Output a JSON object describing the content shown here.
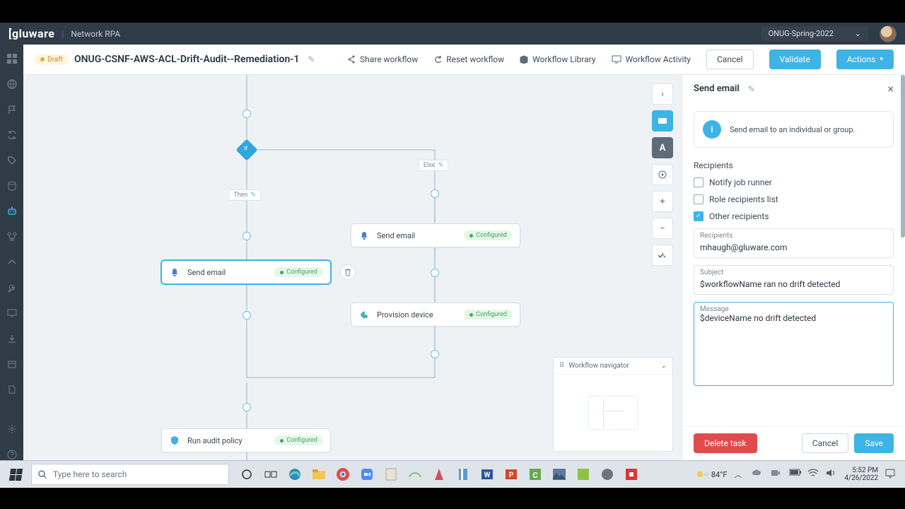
{
  "topbar": {
    "brand": "gluware",
    "product": "Network RPA",
    "project": "ONUG-Spring-2022"
  },
  "workflow": {
    "status": "Draft",
    "name": "ONUG-CSNF-AWS-ACL-Drift-Audit--Remediation-1",
    "actions": {
      "share": "Share workflow",
      "reset": "Reset workflow",
      "library": "Workflow Library",
      "activity": "Workflow Activity",
      "cancel": "Cancel",
      "validate": "Validate",
      "actions": "Actions"
    }
  },
  "canvas": {
    "if_label": "If",
    "then_label": "Then",
    "else_label": "Else",
    "nodes": {
      "send_email_then": {
        "title": "Send email",
        "chip": "Configured"
      },
      "send_email_else": {
        "title": "Send email",
        "chip": "Configured"
      },
      "provision": {
        "title": "Provision device",
        "chip": "Configured"
      },
      "audit": {
        "title": "Run audit policy",
        "chip": "Configured"
      }
    },
    "navigator_title": "Workflow navigator"
  },
  "panel": {
    "title": "Send email",
    "info": "Send email to an individual or group.",
    "recipients_label": "Recipients",
    "notify_runner": "Notify job runner",
    "role_recipients": "Role recipients list",
    "other_recipients": "Other recipients",
    "recipients_field_label": "Recipients",
    "recipients_value": "mhaugh@gluware.com",
    "subject_label": "Subject",
    "subject_value": "$workflowName ran no drift detected",
    "message_label": "Message",
    "message_value": "$deviceName no drift detected",
    "delete": "Delete task",
    "cancel": "Cancel",
    "save": "Save"
  },
  "taskbar": {
    "search_placeholder": "Type here to search",
    "temp": "84°F",
    "time": "5:52 PM",
    "date": "4/26/2022"
  }
}
